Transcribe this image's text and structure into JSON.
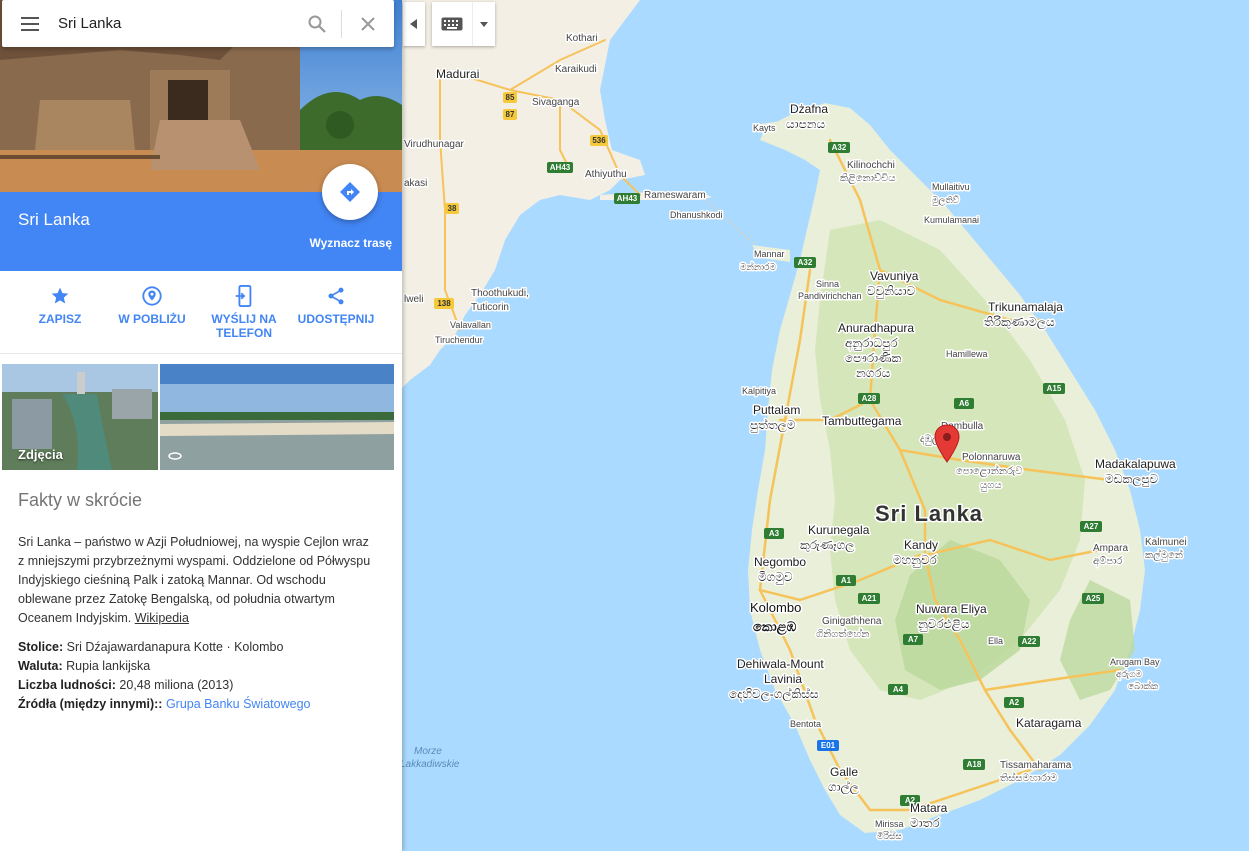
{
  "search": {
    "query": "Sri Lanka"
  },
  "place": {
    "name": "Sri Lanka",
    "route_label": "Wyznacz trasę"
  },
  "actions": [
    {
      "label": "ZAPISZ",
      "icon": "star-icon"
    },
    {
      "label": "W POBLIŻU",
      "icon": "nearby-pin-icon"
    },
    {
      "label": "WYŚLIJ NA TELEFON",
      "icon": "send-to-phone-icon"
    },
    {
      "label": "UDOSTĘPNIJ",
      "icon": "share-icon"
    }
  ],
  "photos": {
    "label": "Zdjęcia",
    "panorama_icon": "360-icon"
  },
  "facts": {
    "title": "Fakty w skrócie",
    "description": "Sri Lanka – państwo w Azji Południowej, na wyspie Cejlon wraz z mniejszymi przybrzeżnymi wyspami. Oddzielone od Półwyspu Indyjskiego cieśniną Palk i zatoką Mannar. Od wschodu oblewane przez Zatokę Bengalską, od południa otwartym Oceanem Indyjskim.",
    "source_link": "Wikipedia",
    "rows": [
      {
        "key": "Stolice:",
        "value": "Sri Dźajawardanapura Kotte · Kolombo"
      },
      {
        "key": "Waluta:",
        "value": "Rupia lankijska"
      },
      {
        "key": "Liczba ludności:",
        "value": "20,48 miliona (2013)"
      },
      {
        "key": "Źródła (między innymi)::",
        "value": "",
        "link": "Grupa Banku Światowego"
      }
    ]
  },
  "map": {
    "country_label": "Sri Lanka",
    "water_label_1": "Morze",
    "water_label_2": "Lakkadiwskie",
    "india_cities": [
      "Kothari",
      "Madurai",
      "Karaikudi",
      "Sivaganga",
      "Virudhunagar",
      "Athiyuthu",
      "Rameswaram",
      "Dhanushkodi",
      "Thoothukudi,",
      "Tuticorin",
      "Valavallan",
      "Tiruchendur",
      "akasi",
      "lweli"
    ],
    "cities": [
      {
        "name": "Dżafna",
        "local": "යාපනය"
      },
      {
        "name": "Kayts",
        "local": ""
      },
      {
        "name": "Kilinochchi",
        "local": "කිළිනොච්චිය"
      },
      {
        "name": "Mullaitivu",
        "local": "මුලතිව්"
      },
      {
        "name": "Kumulamanai",
        "local": ""
      },
      {
        "name": "Mannar",
        "local": "මන්නාරම"
      },
      {
        "name": "Vavuniya",
        "local": "වවුනියාව"
      },
      {
        "name": "Sinna",
        "local": ""
      },
      {
        "name": "Pandivirichchan",
        "local": ""
      },
      {
        "name": "Trikunamalaja",
        "local": "තිරිකුණාමලය"
      },
      {
        "name": "Anuradhapura",
        "local": "අනුරාධපුර"
      },
      {
        "name": "පෞරාණික",
        "local": "නගරය"
      },
      {
        "name": "Hamillewa",
        "local": ""
      },
      {
        "name": "Kalpitiya",
        "local": ""
      },
      {
        "name": "Puttalam",
        "local": "පුත්තලම"
      },
      {
        "name": "Tambuttegama",
        "local": ""
      },
      {
        "name": "Dambulla",
        "local": "දඹුල්ල"
      },
      {
        "name": "Polonnaruwa",
        "local": "පොළොන්නරුව"
      },
      {
        "name": "යුගය",
        "local": ""
      },
      {
        "name": "Madakalapuwa",
        "local": "මඩකලපුව"
      },
      {
        "name": "Kurunegala",
        "local": "කුරුණෑගල"
      },
      {
        "name": "Kandy",
        "local": "මහනුවර"
      },
      {
        "name": "Ampara",
        "local": "අම්පාර"
      },
      {
        "name": "Kalmunei",
        "local": "කල්මුනේ"
      },
      {
        "name": "Negombo",
        "local": "මීගමුව"
      },
      {
        "name": "Kolombo",
        "local": "කොළඹ"
      },
      {
        "name": "Nuwara Eliya",
        "local": "නුවරඑළිය"
      },
      {
        "name": "Ginigathhena",
        "local": "ගිනිගත්හේන"
      },
      {
        "name": "Ella",
        "local": ""
      },
      {
        "name": "Dehiwala-Mount",
        "local": "Lavinia"
      },
      {
        "name": "දෙහිවල-ගල්කිස්ස",
        "local": ""
      },
      {
        "name": "Arugam Bay",
        "local": "අරුගම"
      },
      {
        "name": "බොක්ක",
        "local": ""
      },
      {
        "name": "Bentota",
        "local": ""
      },
      {
        "name": "Kataragama",
        "local": ""
      },
      {
        "name": "Galle",
        "local": "ගාල්ල"
      },
      {
        "name": "Tissamaharama",
        "local": "තිස්සමහාරාම"
      },
      {
        "name": "Matara",
        "local": "මාතර"
      },
      {
        "name": "Mirissa",
        "local": "මිරිස්ස"
      }
    ],
    "road_shields": [
      "85",
      "87",
      "536",
      "AH43",
      "AH43",
      "38",
      "138",
      "A32",
      "A32",
      "A28",
      "A6",
      "A15",
      "A3",
      "A1",
      "A21",
      "A7",
      "A22",
      "A27",
      "A25",
      "A4",
      "A2",
      "E01",
      "A18",
      "A2"
    ]
  }
}
